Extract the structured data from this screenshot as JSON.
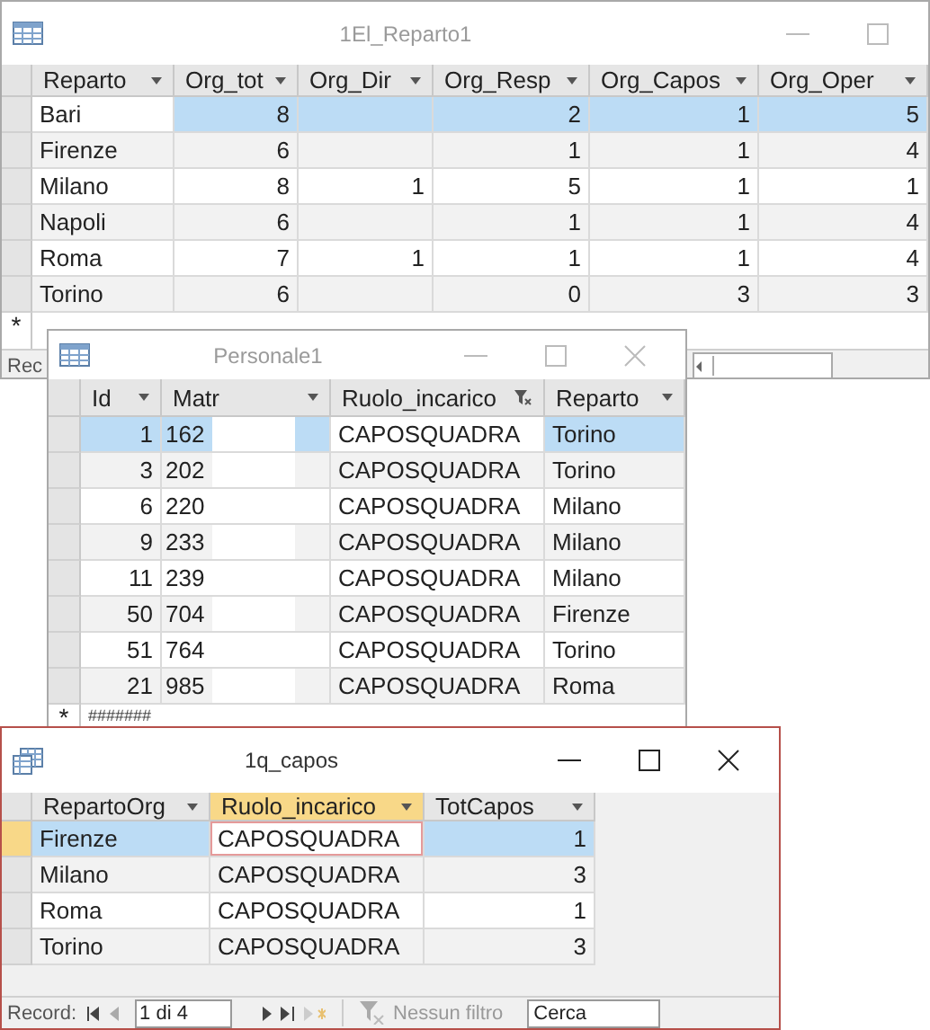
{
  "windows": [
    {
      "kind": "table",
      "title": "1El_Reparto1",
      "active": false,
      "buttons": [
        {
          "kind": "minimize"
        },
        {
          "kind": "maximize"
        }
      ],
      "columns": [
        {
          "label": "Reparto",
          "kind": "text",
          "filtered": false
        },
        {
          "label": "Org_tot",
          "kind": "number",
          "filtered": false
        },
        {
          "label": "Org_Dir",
          "kind": "number",
          "filtered": false
        },
        {
          "label": "Org_Resp",
          "kind": "number",
          "filtered": false
        },
        {
          "label": "Org_Capos",
          "kind": "number",
          "filtered": false
        },
        {
          "label": "Org_Oper",
          "kind": "number",
          "filtered": false
        }
      ],
      "rows": [
        {
          "cells": [
            {
              "text": "Bari",
              "current": true
            },
            "8",
            null,
            "2",
            "1",
            "5"
          ],
          "selected": true
        },
        {
          "cells": [
            "Firenze",
            "6",
            null,
            "1",
            "1",
            "4"
          ],
          "selected": false
        },
        {
          "cells": [
            "Milano",
            "8",
            "1",
            "5",
            "1",
            "1"
          ],
          "selected": false
        },
        {
          "cells": [
            "Napoli",
            "6",
            null,
            "1",
            "1",
            "4"
          ],
          "selected": false
        },
        {
          "cells": [
            "Roma",
            "7",
            "1",
            "1",
            "1",
            "4"
          ],
          "selected": false
        },
        {
          "cells": [
            "Torino",
            "6",
            null,
            "0",
            "3",
            "3"
          ],
          "selected": false
        }
      ],
      "new_row": {
        "marker": "*"
      },
      "record_bar": {
        "label": "Rec"
      }
    },
    {
      "kind": "table",
      "title": "Personale1",
      "active": false,
      "buttons": [
        {
          "kind": "minimize"
        },
        {
          "kind": "maximize"
        },
        {
          "kind": "close"
        }
      ],
      "columns": [
        {
          "label": "Id",
          "kind": "number",
          "filtered": false
        },
        {
          "label": "Matr",
          "kind": "redacted",
          "filtered": false
        },
        {
          "label": "Ruolo_incarico",
          "kind": "text",
          "filtered": true
        },
        {
          "label": "Reparto",
          "kind": "text",
          "filtered": false
        }
      ],
      "rows": [
        {
          "cells": [
            "1",
            "162",
            {
              "text": "CAPOSQUADRA",
              "current": true
            },
            "Torino"
          ],
          "selected": true
        },
        {
          "cells": [
            "3",
            "202",
            "CAPOSQUADRA",
            "Torino"
          ],
          "selected": false
        },
        {
          "cells": [
            "6",
            "220",
            "CAPOSQUADRA",
            "Milano"
          ],
          "selected": false
        },
        {
          "cells": [
            "9",
            "233",
            "CAPOSQUADRA",
            "Milano"
          ],
          "selected": false
        },
        {
          "cells": [
            "11",
            "239",
            "CAPOSQUADRA",
            "Milano"
          ],
          "selected": false
        },
        {
          "cells": [
            "50",
            "704",
            "CAPOSQUADRA",
            "Firenze"
          ],
          "selected": false
        },
        {
          "cells": [
            "51",
            "764",
            "CAPOSQUADRA",
            "Torino"
          ],
          "selected": false
        },
        {
          "cells": [
            "21",
            "985",
            "CAPOSQUADRA",
            "Roma"
          ],
          "selected": false
        }
      ],
      "new_row": {
        "marker": "*",
        "cells": [
          "#######"
        ]
      }
    },
    {
      "kind": "query",
      "title": "1q_capos",
      "active": true,
      "buttons": [
        {
          "kind": "minimize"
        },
        {
          "kind": "maximize"
        },
        {
          "kind": "close"
        }
      ],
      "columns": [
        {
          "label": "RepartoOrg",
          "kind": "text",
          "current": false,
          "filtered": false
        },
        {
          "label": "Ruolo_incarico",
          "kind": "text",
          "current": true,
          "filtered": false
        },
        {
          "label": "TotCapos",
          "kind": "number",
          "current": false,
          "filtered": false
        }
      ],
      "rows": [
        {
          "cells": [
            "Firenze",
            {
              "text": "CAPOSQUADRA",
              "current": true
            },
            "1"
          ],
          "selected": true
        },
        {
          "cells": [
            "Milano",
            "CAPOSQUADRA",
            "3"
          ],
          "selected": false
        },
        {
          "cells": [
            "Roma",
            "CAPOSQUADRA",
            "1"
          ],
          "selected": false
        },
        {
          "cells": [
            "Torino",
            "CAPOSQUADRA",
            "3"
          ],
          "selected": false
        }
      ],
      "record_bar": {
        "label": "Record:",
        "position": "1 di 4",
        "filter_label": "Nessun filtro",
        "filter_active": false,
        "search_placeholder": "Cerca"
      }
    }
  ]
}
